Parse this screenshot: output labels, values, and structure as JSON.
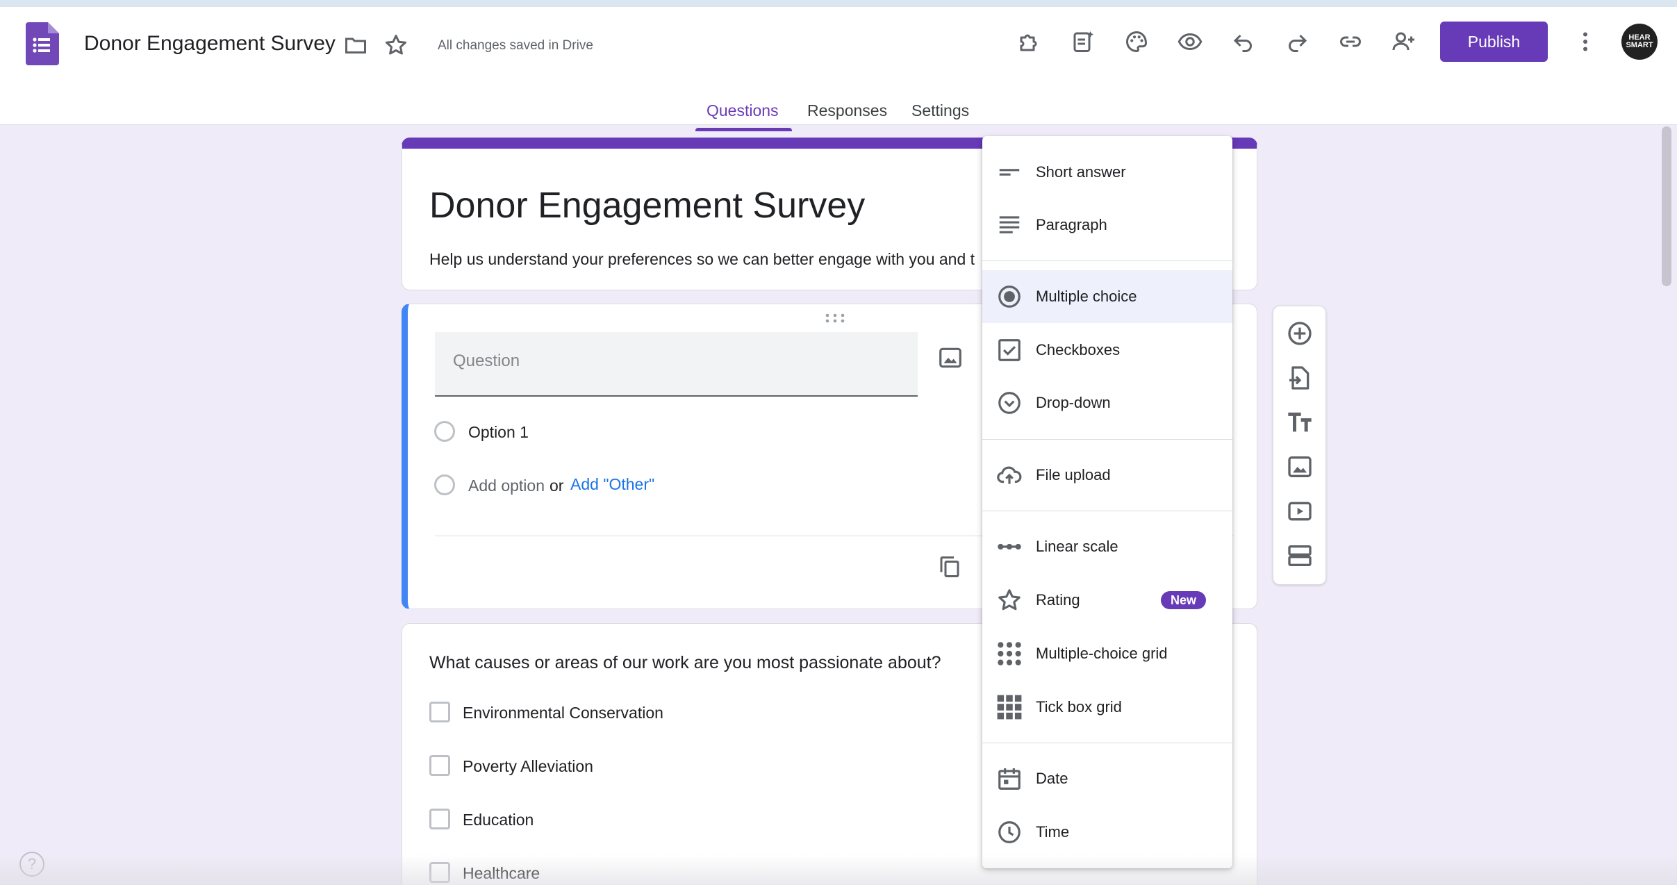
{
  "header": {
    "doc_title": "Donor Engagement Survey",
    "saved_status": "All changes saved in Drive",
    "publish_label": "Publish",
    "avatar_text": "HEAR SMART",
    "icons": [
      "forms-logo-icon",
      "folder-icon",
      "star-icon",
      "addon-puzzle-icon",
      "ai-form-icon",
      "palette-icon",
      "preview-eye-icon",
      "undo-icon",
      "redo-icon",
      "link-icon",
      "add-collaborator-icon",
      "more-vert-icon"
    ]
  },
  "tabs": [
    {
      "label": "Questions",
      "active": true
    },
    {
      "label": "Responses",
      "active": false
    },
    {
      "label": "Settings",
      "active": false
    }
  ],
  "form": {
    "title": "Donor Engagement Survey",
    "description": "Help us understand your preferences so we can better engage with you and t"
  },
  "question_editor": {
    "placeholder": "Question",
    "option_1": "Option 1",
    "add_option": "Add option",
    "or": "or",
    "add_other": "Add \"Other\""
  },
  "question_2": {
    "text": "What causes or areas of our work are you most passionate about?",
    "options": [
      "Environmental Conservation",
      "Poverty Alleviation",
      "Education",
      "Healthcare"
    ]
  },
  "type_menu": {
    "items": [
      {
        "label": "Short answer",
        "icon": "short-answer-icon"
      },
      {
        "label": "Paragraph",
        "icon": "paragraph-icon"
      },
      {
        "label": "Multiple choice",
        "icon": "radio-icon",
        "selected": true
      },
      {
        "label": "Checkboxes",
        "icon": "checkbox-icon"
      },
      {
        "label": "Drop-down",
        "icon": "dropdown-icon"
      },
      {
        "label": "File upload",
        "icon": "cloud-upload-icon"
      },
      {
        "label": "Linear scale",
        "icon": "linear-scale-icon"
      },
      {
        "label": "Rating",
        "icon": "star-outline-icon",
        "badge": "New"
      },
      {
        "label": "Multiple-choice grid",
        "icon": "dots-grid-icon"
      },
      {
        "label": "Tick box grid",
        "icon": "tick-grid-icon"
      },
      {
        "label": "Date",
        "icon": "calendar-icon"
      },
      {
        "label": "Time",
        "icon": "clock-icon"
      }
    ]
  },
  "side_toolbar": {
    "icons": [
      "add-question-icon",
      "import-questions-icon",
      "add-title-icon",
      "add-image-icon",
      "add-video-icon",
      "add-section-icon"
    ]
  },
  "help_label": "?",
  "colors": {
    "accent": "#673ab7",
    "active_question_bar": "#4285f4",
    "link": "#1a73e8",
    "page_bg": "#f0ebf8"
  }
}
